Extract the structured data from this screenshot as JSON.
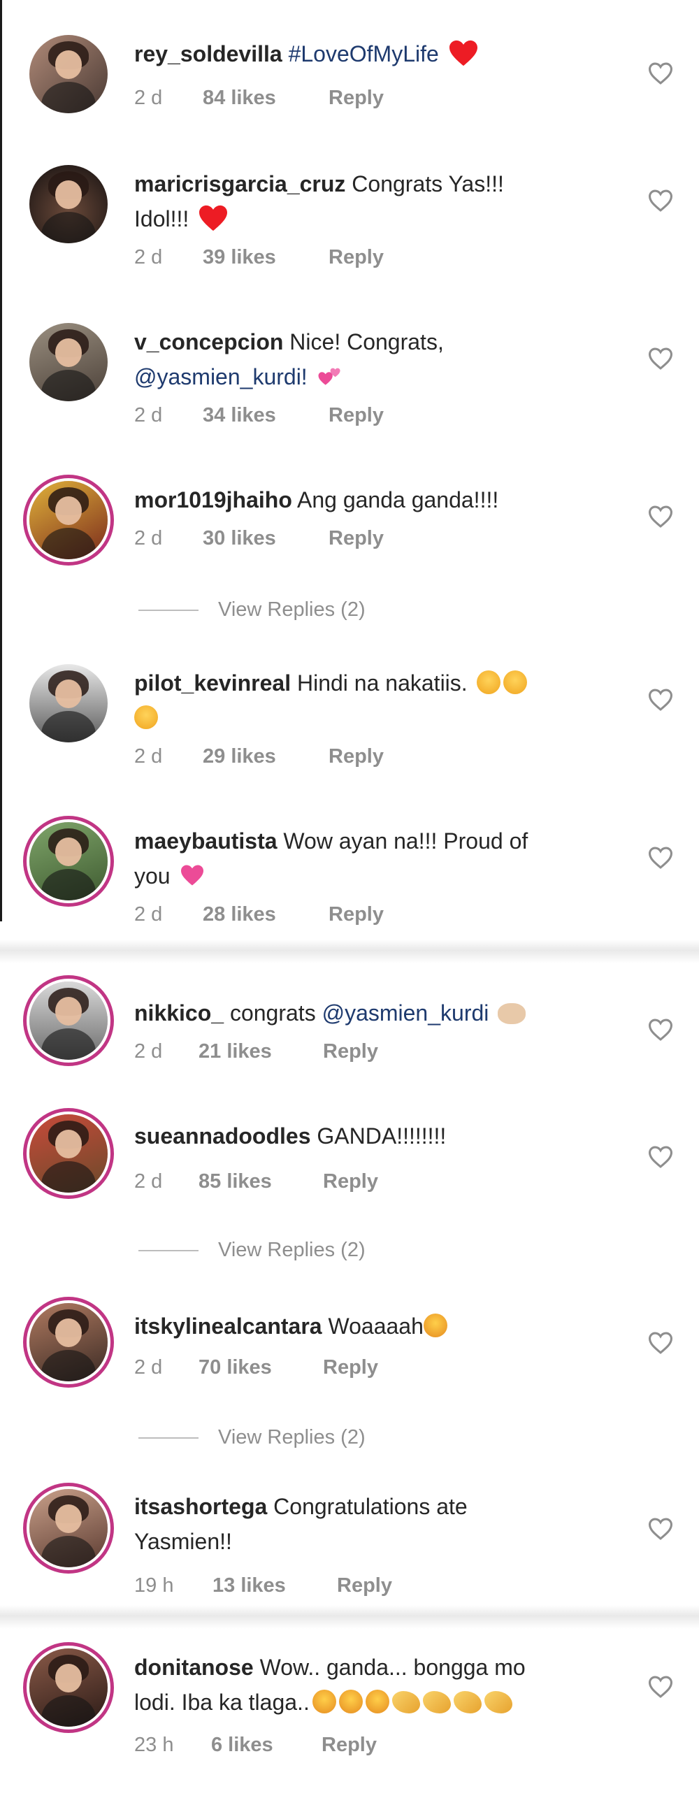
{
  "colors": {
    "accent_ring": "#c13584",
    "muted": "#8e8e8e",
    "text": "#262626",
    "mention": "#1e3a6e",
    "heart": "#ed1c24"
  },
  "comments": [
    {
      "username": "rey_soldevilla",
      "hashtag": "#LoveOfMyLife",
      "emoji": [
        "heart-red"
      ],
      "time": "2 d",
      "likes": "84 likes",
      "reply": "Reply"
    },
    {
      "username": "maricrisgarcia_cruz",
      "text": "Congrats Yas!!!",
      "text2": "Idol!!!",
      "emoji": [
        "heart-red"
      ],
      "time": "2 d",
      "likes": "39 likes",
      "reply": "Reply"
    },
    {
      "username": "v_concepcion",
      "text": "Nice! Congrats,",
      "mention": "@yasmien_kurdi!",
      "emoji": [
        "two-hearts"
      ],
      "time": "2 d",
      "likes": "34 likes",
      "reply": "Reply"
    },
    {
      "username": "mor1019jhaiho",
      "text": "Ang ganda ganda!!!!",
      "time": "2 d",
      "likes": "30 likes",
      "reply": "Reply",
      "view_replies": "View Replies (2)"
    },
    {
      "username": "pilot_kevinreal",
      "text": "Hindi na nakatiis.",
      "emoji": [
        "grinning-sweat",
        "grinning-sweat",
        "grinning-sweat"
      ],
      "time": "2 d",
      "likes": "29 likes",
      "reply": "Reply"
    },
    {
      "username": "maeybautista",
      "text": "Wow ayan na!!! Proud of",
      "text2": "you",
      "emoji": [
        "pink-heart"
      ],
      "time": "2 d",
      "likes": "28 likes",
      "reply": "Reply"
    },
    {
      "username": "nikkico_",
      "text": "congrats",
      "mention": "@yasmien_kurdi",
      "emoji": [
        "muscle"
      ],
      "time": "2 d",
      "likes": "21 likes",
      "reply": "Reply"
    },
    {
      "username": "sueannadoodles",
      "text": "GANDA!!!!!!!!",
      "time": "2 d",
      "likes": "85 likes",
      "reply": "Reply",
      "view_replies": "View Replies (2)"
    },
    {
      "username": "itskylinealcantara",
      "text": "Woaaaah",
      "emoji": [
        "heart-eyes"
      ],
      "time": "2 d",
      "likes": "70 likes",
      "reply": "Reply",
      "view_replies": "View Replies (2)"
    },
    {
      "username": "itsashortega",
      "text": "Congratulations ate",
      "text2": "Yasmien!!",
      "time": "19 h",
      "likes": "13 likes",
      "reply": "Reply"
    },
    {
      "username": "donitanose",
      "text": "Wow.. ganda... bongga mo",
      "text2": "lodi. Iba ka tlaga..",
      "emoji": [
        "smile-eyes",
        "smile-eyes",
        "smile-eyes",
        "clap",
        "clap",
        "clap",
        "clap"
      ],
      "time": "23 h",
      "likes": "6 likes",
      "reply": "Reply"
    }
  ]
}
